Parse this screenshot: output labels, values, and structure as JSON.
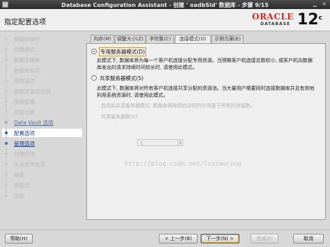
{
  "window": {
    "title": "Database Configuration Assistant - 创建 ' oadbSid' 数据库 - 步骤 9/15",
    "minimize_glyph": "▁",
    "close_glyph": "✕"
  },
  "header": {
    "page_title": "指定配置选项",
    "logo_oracle": "ORACLE",
    "logo_database": "DATABASE",
    "version": "12",
    "version_suffix": "c"
  },
  "steps": [
    {
      "label": "数据库操作",
      "state": "disabled"
    },
    {
      "label": "创建模式",
      "state": "disabled"
    },
    {
      "label": "数据库模板",
      "state": "disabled"
    },
    {
      "label": "数据库标识",
      "state": "disabled"
    },
    {
      "label": "管理选项",
      "state": "disabled"
    },
    {
      "label": "数据库身份证明",
      "state": "disabled"
    },
    {
      "label": "网络配置",
      "state": "disabled"
    },
    {
      "label": "存储位置",
      "state": "disabled"
    },
    {
      "label": "Data Vault 选项",
      "state": "done"
    },
    {
      "label": "配置选项",
      "state": "current"
    },
    {
      "label": "管理选项",
      "state": "next"
    },
    {
      "label": "创建选项",
      "state": "disabled"
    },
    {
      "label": "先决条件检查",
      "state": "disabled"
    },
    {
      "label": "概要",
      "state": "disabled"
    },
    {
      "label": "进度页",
      "state": "disabled"
    },
    {
      "label": "完成",
      "state": "disabled"
    }
  ],
  "tabs": [
    "内存(M)",
    "调整大小(Z)",
    "字符集(C)",
    "连接模式(O)",
    "示例方案(E)"
  ],
  "active_tab_index": 3,
  "options": {
    "dedicated": {
      "label": "专用服务器模式(D)",
      "selected": true,
      "description_line1": "此模式下, 数据库将为每一个客户机连接分配专用资源。当预期客户机连接总数较小, 或客户机向数据",
      "description_line2": "库发出的请求持续时间较长时, 请使用此模式。"
    },
    "shared": {
      "label": "共享服务器模式(S)",
      "selected": false,
      "description_line1": "此模式下, 数据库将对所有客户机连接共享分配的资源池。当大量用户需要同时连接数据库并且有效地",
      "description_line2": "利用系统资源时, 请使用此模式。",
      "faded_note": "启用此共享服务器模式, 数据库将按照启动时的引用基于所需的进程数。",
      "server_count_label": "共享服务器数(V):",
      "server_count_value": "1"
    }
  },
  "watermark": "http://blog.csdn.net/lvshaorong",
  "buttons": {
    "help": "帮助(H)",
    "back": "< 上一步(B)",
    "next": "下一步(N) >",
    "finish": "完成(F)",
    "cancel": "取消"
  }
}
